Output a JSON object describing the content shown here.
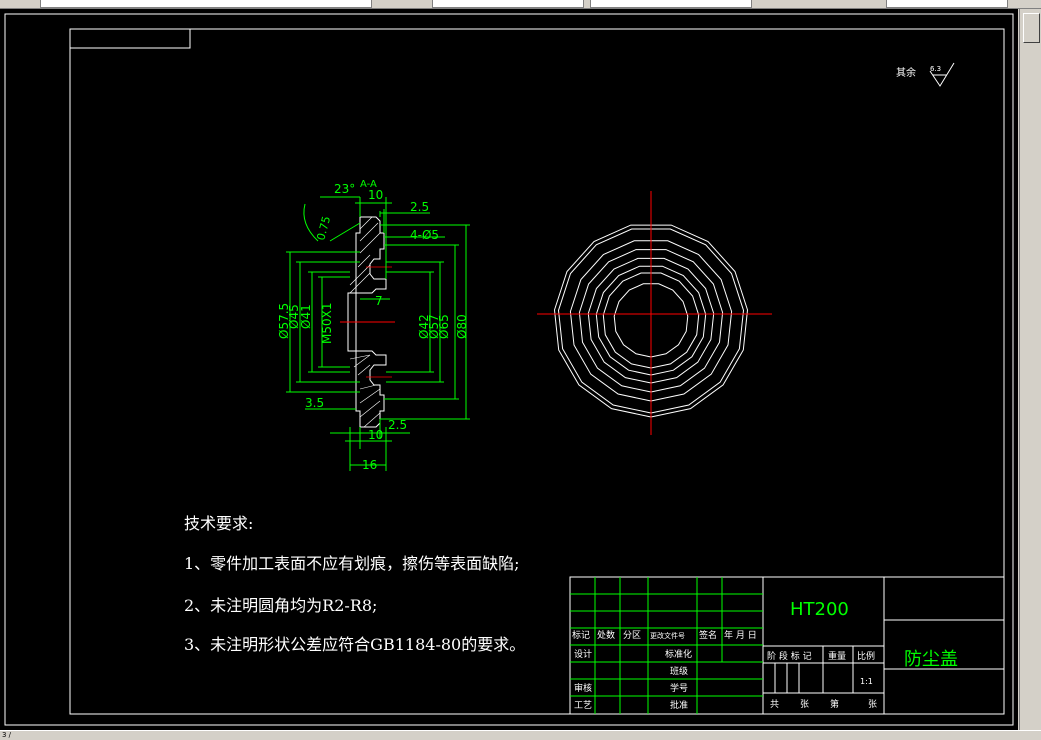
{
  "toolbar": {
    "cells": [
      "",
      "",
      "",
      ""
    ]
  },
  "drawing": {
    "surface_note_label": "其余",
    "surface_note_value": "6.3",
    "section_label": "A-A",
    "dims": {
      "angle": "23°",
      "d10_top": "10",
      "d2_5_top": "2.5",
      "chamfer": "0.75",
      "holes": "4-Ø5",
      "d7": "7",
      "d57_5": "Ø57.5",
      "d45": "Ø45",
      "d41": "Ø41",
      "thread": "M50X1",
      "d42": "Ø42",
      "d57": "Ø57",
      "d65": "Ø65",
      "d80": "Ø80",
      "d3_5": "3.5",
      "d2_5_bot": "2.5",
      "d10_bot": "10",
      "d16": "16"
    },
    "notes_title": "技术要求:",
    "notes": [
      "1、零件加工表面不应有划痕，擦伤等表面缺陷;",
      "2、未注明圆角均为R2-R8;",
      "3、未注明形状公差应符合GB1184-80的要求。"
    ]
  },
  "title_block": {
    "material": "HT200",
    "part_name": "防尘盖",
    "header": [
      "标记",
      "处数",
      "分区",
      "更改文件号",
      "签名",
      "年 月 日"
    ],
    "row_design": "设计",
    "row_std": "标准化",
    "row_class": "班级",
    "row_check": "审核",
    "row_num": "学号",
    "row_proc": "工艺",
    "row_approve": "批准",
    "stage_label": "阶 段 标 记",
    "weight_label": "重量",
    "scale_label": "比例",
    "scale_value": "1:1",
    "sheets_label_1": "共",
    "sheets_label_2": "张",
    "sheets_label_3": "第",
    "sheets_label_4": "张"
  },
  "status": {
    "text": "3 /"
  },
  "colors": {
    "background": "#000000",
    "dimension": "#00ff00",
    "outline": "#ffffff",
    "centerline": "#ff0000"
  }
}
